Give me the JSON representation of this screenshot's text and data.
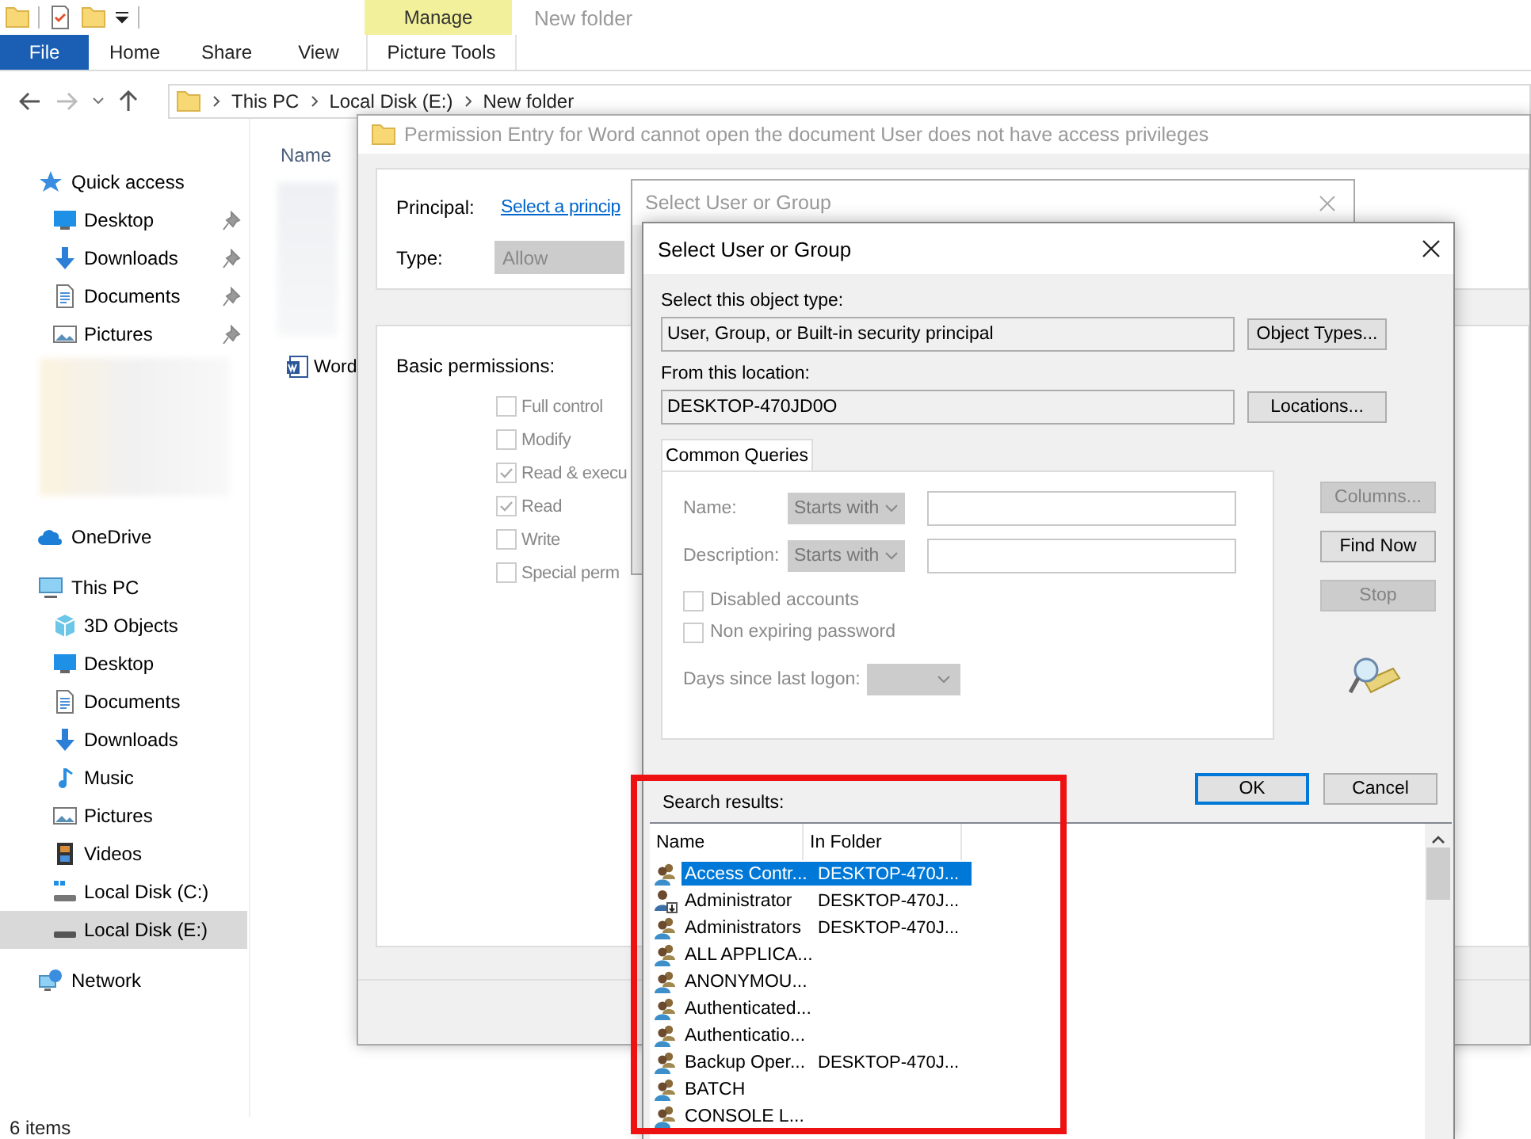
{
  "explorer": {
    "title": "New folder",
    "context_tab_group": "Manage",
    "ribbon_tabs": [
      {
        "label": "File",
        "kind": "file"
      },
      {
        "label": "Home",
        "kind": "plain"
      },
      {
        "label": "Share",
        "kind": "plain"
      },
      {
        "label": "View",
        "kind": "plain"
      },
      {
        "label": "Picture Tools",
        "kind": "context"
      }
    ],
    "address": [
      "This PC",
      "Local Disk (E:)",
      "New folder"
    ],
    "navigation": [
      {
        "label": "Quick access",
        "kind": "star",
        "selected": false,
        "redacted": true,
        "children": [
          {
            "label": "Desktop",
            "kind": "desktop",
            "pinned": true,
            "selected": false
          },
          {
            "label": "Downloads",
            "kind": "downloads",
            "pinned": true,
            "selected": false
          },
          {
            "label": "Documents",
            "kind": "documents",
            "pinned": true,
            "selected": false
          },
          {
            "label": "Pictures",
            "kind": "pictures",
            "pinned": true,
            "selected": false
          }
        ]
      },
      {
        "label": "OneDrive",
        "kind": "cloud",
        "selected": false
      },
      {
        "label": "This PC",
        "kind": "computer",
        "selected": false,
        "children": [
          {
            "label": "3D Objects",
            "kind": "cube",
            "selected": false
          },
          {
            "label": "Desktop",
            "kind": "desktop",
            "selected": false
          },
          {
            "label": "Documents",
            "kind": "documents",
            "selected": false
          },
          {
            "label": "Downloads",
            "kind": "downloads",
            "selected": false
          },
          {
            "label": "Music",
            "kind": "music",
            "selected": false
          },
          {
            "label": "Pictures",
            "kind": "pictures",
            "selected": false
          },
          {
            "label": "Videos",
            "kind": "videos",
            "selected": false
          },
          {
            "label": "Local Disk (C:)",
            "kind": "system-drive",
            "selected": false
          },
          {
            "label": "Local Disk (E:)",
            "kind": "drive",
            "selected": true
          }
        ]
      },
      {
        "label": "Network",
        "kind": "network",
        "selected": false
      }
    ],
    "column_header": "Name",
    "files": [
      {
        "name": "Word",
        "kind": "word-document"
      }
    ],
    "status": "6 items"
  },
  "permission_entry": {
    "title": "Permission Entry for Word cannot open the document User does not have access privileges",
    "principal_label": "Principal:",
    "principal_link": "Select a princip",
    "type_label": "Type:",
    "type_value": "Allow",
    "permissions_label": "Basic permissions:",
    "permissions": [
      {
        "label": "Full control",
        "checked": false
      },
      {
        "label": "Modify",
        "checked": false
      },
      {
        "label": "Read & execu",
        "checked": true
      },
      {
        "label": "Read",
        "checked": true
      },
      {
        "label": "Write",
        "checked": false
      },
      {
        "label": "Special perm",
        "checked": false
      }
    ]
  },
  "back_dialog": {
    "title": "Select User or Group"
  },
  "dialog": {
    "title": "Select User or Group",
    "object_type_label": "Select this object type:",
    "object_type": "User, Group, or Built-in security principal",
    "object_types_button": "Object Types...",
    "location_label": "From this location:",
    "location": "DESKTOP-470JD0O",
    "locations_button": "Locations...",
    "tab": "Common Queries",
    "name_label": "Name:",
    "name_operator": "Starts with",
    "description_label": "Description:",
    "description_operator": "Starts with",
    "options": [
      {
        "label": "Disabled accounts",
        "checked": false
      },
      {
        "label": "Non expiring password",
        "checked": false
      }
    ],
    "days_label": "Days since last logon:",
    "side_buttons": [
      {
        "label": "Columns...",
        "disabled": true
      },
      {
        "label": "Find Now",
        "disabled": false
      },
      {
        "label": "Stop",
        "disabled": true
      }
    ],
    "ok_button": "OK",
    "cancel_button": "Cancel",
    "results_label": "Search results:",
    "columns": [
      "Name",
      "In Folder"
    ],
    "results": [
      {
        "name": "Access Contr...",
        "folder": "DESKTOP-470J...",
        "kind": "group",
        "selected": true
      },
      {
        "name": "Administrator",
        "folder": "DESKTOP-470J...",
        "kind": "user",
        "selected": false
      },
      {
        "name": "Administrators",
        "folder": "DESKTOP-470J...",
        "kind": "group",
        "selected": false
      },
      {
        "name": "ALL APPLICA...",
        "kind": "group",
        "selected": false
      },
      {
        "name": "ANONYMOU...",
        "kind": "group",
        "selected": false
      },
      {
        "name": "Authenticated...",
        "kind": "group",
        "selected": false
      },
      {
        "name": "Authenticatio...",
        "kind": "group",
        "selected": false
      },
      {
        "name": "Backup Oper...",
        "folder": "DESKTOP-470J...",
        "kind": "group",
        "selected": false
      },
      {
        "name": "BATCH",
        "kind": "group",
        "selected": false
      },
      {
        "name": "CONSOLE L...",
        "kind": "group",
        "selected": false
      }
    ]
  },
  "highlight": {
    "kind": "rectangle"
  }
}
